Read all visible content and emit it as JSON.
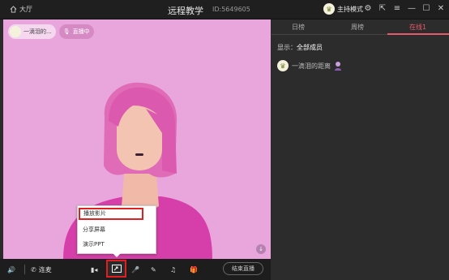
{
  "titlebar": {
    "home_label": "大厅",
    "title": "远程教学",
    "room_id": "ID:5649605",
    "host_mode": "主持模式"
  },
  "video": {
    "host_name": "一滴泪的...",
    "live_label": "直播中"
  },
  "controls": {
    "connect_label": "连麦",
    "end_label": "结束直播"
  },
  "share_menu": {
    "items": [
      "播放影片",
      "分享屏幕",
      "演示PPT"
    ],
    "selected": "播放影片"
  },
  "panel": {
    "tabs": [
      "日榜",
      "周榜",
      "在线1"
    ],
    "active_tab": "在线1",
    "filter_prefix": "显示：",
    "filter_value": "全部成员",
    "users": [
      {
        "name": "一滴泪的距离"
      }
    ]
  },
  "colors": {
    "accent": "#e85a6b",
    "highlight_box": "#e02020",
    "video_bg": "#e9a6dd"
  }
}
